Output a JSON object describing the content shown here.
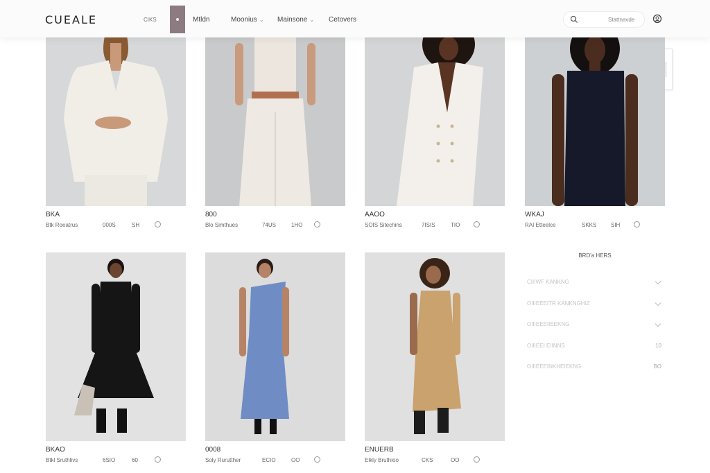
{
  "header": {
    "logo": "CUEALE",
    "nav_small": "CIKS",
    "nav": [
      {
        "label": "Mtldn",
        "chevron": ""
      },
      {
        "label": "Moonius",
        "chevron": "⌄"
      },
      {
        "label": "Mainsone",
        "chevron": "⌄"
      },
      {
        "label": "Cetovers",
        "chevron": ""
      }
    ],
    "search_placeholder": "Stattnavde"
  },
  "products": [
    {
      "price": "BKA",
      "name": "Btk Roeatrus",
      "code": "000S",
      "size": "SH",
      "colors": {
        "bg": "#d6d8d9",
        "garment": "#f1eee8",
        "skin": "#c89a7a",
        "hair": "#8a5a33"
      },
      "outfit": "suit"
    },
    {
      "price": "800",
      "name": "Blo Simthues",
      "code": "74US",
      "size": "1HO",
      "colors": {
        "bg": "#c9cacb",
        "garment": "#ece6df",
        "skin": "#c99b7d",
        "hair": "#5a3a22",
        "accent": "#b0704f"
      },
      "outfit": "jumpsuit"
    },
    {
      "price": "AAOO",
      "name": "SOIS Sitechins",
      "code": "7ISIS",
      "size": "TIO",
      "colors": {
        "bg": "#d4d5d6",
        "garment": "#f3f0ec",
        "skin": "#5a3422",
        "hair": "#1e1410"
      },
      "outfit": "coat"
    },
    {
      "price": "WKAJ",
      "name": "RAI Etteelce",
      "code": "SKKS",
      "size": "SIH",
      "colors": {
        "bg": "#cdd0d2",
        "garment": "#15192a",
        "skin": "#4b2d1f",
        "hair": "#151010"
      },
      "outfit": "dark"
    },
    {
      "price": "BKAO",
      "name": "Btkl Sruthlivs",
      "code": "6SIO",
      "size": "60",
      "colors": {
        "bg": "#e2e2e2",
        "garment": "#151515",
        "skin": "#6b4530",
        "hair": "#1a1210"
      },
      "outfit": "blackdress"
    },
    {
      "price": "0008",
      "name": "Soly Rurutther",
      "code": "ECIO",
      "size": "OO",
      "colors": {
        "bg": "#dcdcdc",
        "garment": "#6f8dc4",
        "skin": "#b68366",
        "hair": "#2a1d16"
      },
      "outfit": "bluedress"
    },
    {
      "price": "ENUERB",
      "name": "Elkly Bruthioo",
      "code": "CKS",
      "size": "OO",
      "colors": {
        "bg": "#e0e0e0",
        "garment": "#c9a26e",
        "skin": "#9a6a4c",
        "hair": "#3a2418"
      },
      "outfit": "tan"
    }
  ],
  "filters": {
    "title": "BRD'a HERS",
    "items": [
      {
        "label": "CIIIWF KANKNG",
        "value": "",
        "type": "chevron"
      },
      {
        "label": "OIIIEEEITR KANKNGHIZ",
        "value": "",
        "type": "chevron"
      },
      {
        "label": "OIIIEEEIIEEKNG",
        "value": "",
        "type": "chevron"
      },
      {
        "label": "OIIIEEI EIINNS",
        "value": "10",
        "type": "value"
      },
      {
        "label": "OIIIEEEINKHEIEKNG",
        "value": "BO",
        "type": "value"
      }
    ]
  }
}
